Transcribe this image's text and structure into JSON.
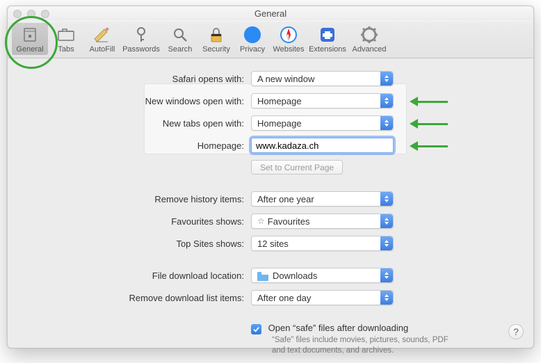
{
  "window": {
    "title": "General"
  },
  "toolbar": {
    "items": [
      {
        "label": "General"
      },
      {
        "label": "Tabs"
      },
      {
        "label": "AutoFill"
      },
      {
        "label": "Passwords"
      },
      {
        "label": "Search"
      },
      {
        "label": "Security"
      },
      {
        "label": "Privacy"
      },
      {
        "label": "Websites"
      },
      {
        "label": "Extensions"
      },
      {
        "label": "Advanced"
      }
    ]
  },
  "rows": {
    "safari_opens": {
      "label": "Safari opens with:",
      "value": "A new window"
    },
    "new_windows": {
      "label": "New windows open with:",
      "value": "Homepage"
    },
    "new_tabs": {
      "label": "New tabs open with:",
      "value": "Homepage"
    },
    "homepage": {
      "label": "Homepage:",
      "value": "www.kadaza.ch"
    },
    "set_current": {
      "label": "Set to Current Page"
    },
    "remove_history": {
      "label": "Remove history items:",
      "value": "After one year"
    },
    "favourites": {
      "label": "Favourites shows:",
      "value": "Favourites",
      "icon": "star"
    },
    "top_sites": {
      "label": "Top Sites shows:",
      "value": "12 sites"
    },
    "download_loc": {
      "label": "File download location:",
      "value": "Downloads",
      "icon": "folder"
    },
    "remove_downloads": {
      "label": "Remove download list items:",
      "value": "After one day"
    },
    "open_safe": {
      "label": "Open “safe” files after downloading",
      "checked": true
    },
    "safe_help": "“Safe” files include movies, pictures, sounds, PDF and text documents, and archives."
  },
  "annotations": {
    "circle_target": "general-tab",
    "arrows": [
      "new-windows-select",
      "new-tabs-select",
      "homepage-input"
    ]
  },
  "colors": {
    "accent": "#3d7de0",
    "annotation": "#3ba839"
  }
}
